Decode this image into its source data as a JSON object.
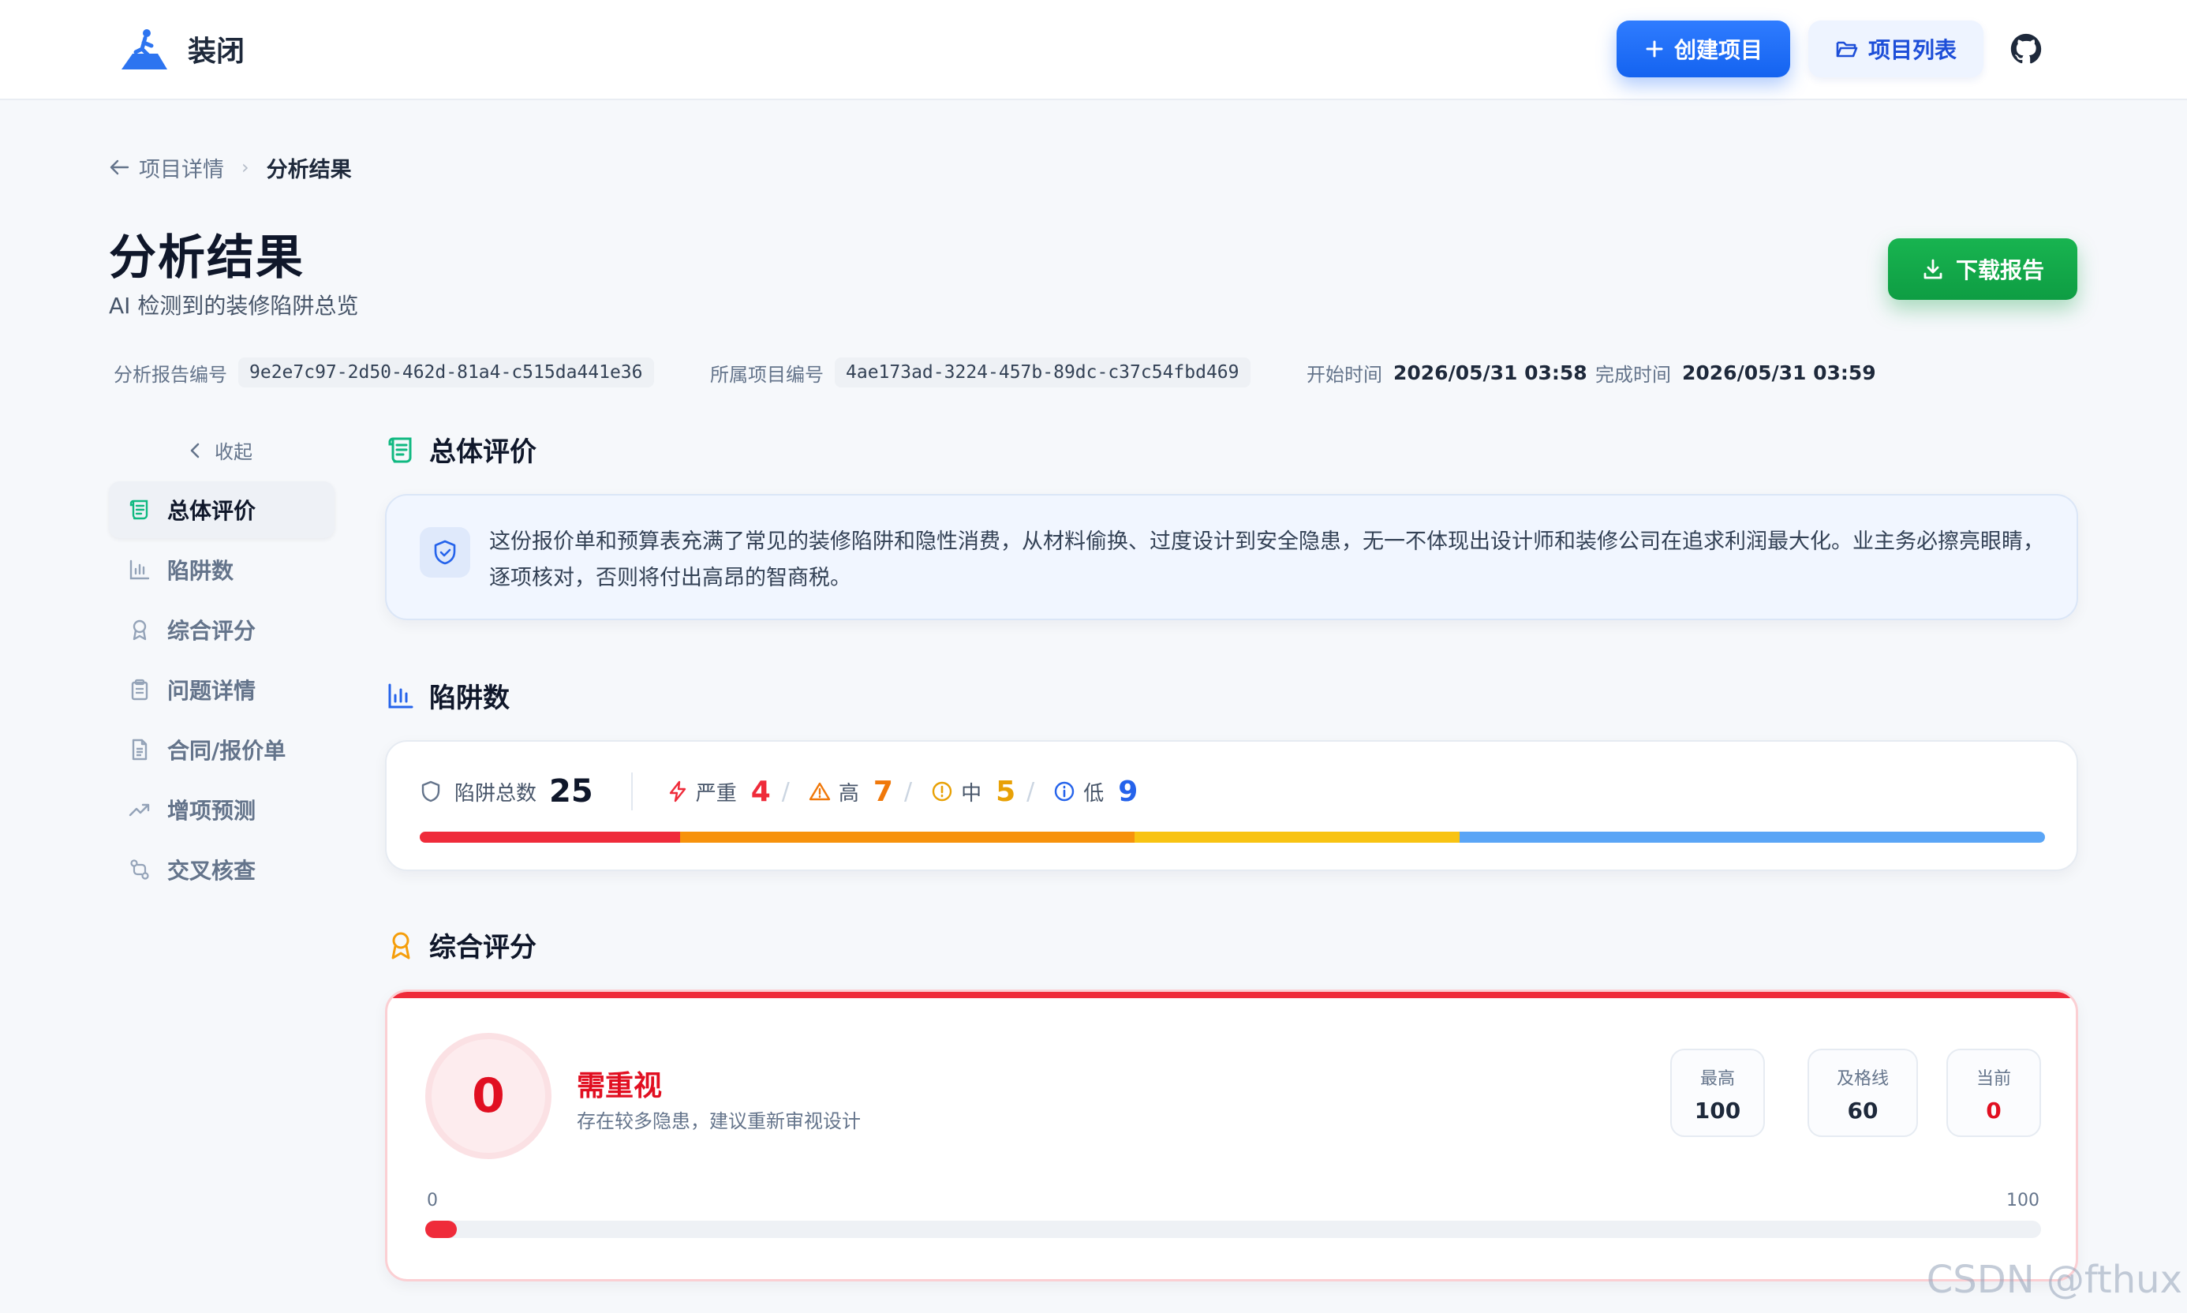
{
  "app": {
    "name": "装闭"
  },
  "topbar": {
    "create_label": "创建项目",
    "list_label": "项目列表"
  },
  "breadcrumb": {
    "back_label": "项目详情",
    "current": "分析结果"
  },
  "header": {
    "title": "分析结果",
    "subtitle": "AI 检测到的装修陷阱总览",
    "download_label": "下载报告"
  },
  "meta": {
    "report_key": "分析报告编号",
    "report_id": "9e2e7c97-2d50-462d-81a4-c515da441e36",
    "project_key": "所属项目编号",
    "project_id": "4ae173ad-3224-457b-89dc-c37c54fbd469",
    "start_key": "开始时间",
    "start_value": "2026/05/31 03:58",
    "end_key": "完成时间",
    "end_value": "2026/05/31 03:59"
  },
  "sidebar": {
    "collapse_label": "收起",
    "items": [
      {
        "label": "总体评价",
        "icon": "scroll-icon"
      },
      {
        "label": "陷阱数",
        "icon": "bar-chart-icon"
      },
      {
        "label": "综合评分",
        "icon": "award-icon"
      },
      {
        "label": "问题详情",
        "icon": "clipboard-icon"
      },
      {
        "label": "合同/报价单",
        "icon": "file-text-icon"
      },
      {
        "label": "增项预测",
        "icon": "trending-up-icon"
      },
      {
        "label": "交叉核查",
        "icon": "git-compare-icon"
      }
    ]
  },
  "overall": {
    "heading": "总体评价",
    "text": "这份报价单和预算表充满了常见的装修陷阱和隐性消费，从材料偷换、过度设计到安全隐患，无一不体现出设计师和装修公司在追求利润最大化。业主务必擦亮眼睛，逐项核对，否则将付出高昂的智商税。"
  },
  "traps": {
    "heading": "陷阱数",
    "total_label": "陷阱总数",
    "total": "25",
    "severities": [
      {
        "label": "严重",
        "count": "4",
        "color": "#ef2b3a",
        "value": 4
      },
      {
        "label": "高",
        "count": "7",
        "color": "#f0780a",
        "value": 7
      },
      {
        "label": "中",
        "count": "5",
        "color": "#e8a106",
        "value": 5
      },
      {
        "label": "低",
        "count": "9",
        "color": "#2563eb",
        "value": 9
      }
    ],
    "bar_colors": [
      "#ef2b3a",
      "#f7920c",
      "#f8c312",
      "#5aa5f6"
    ]
  },
  "score": {
    "heading": "综合评分",
    "value": "0",
    "status": "需重视",
    "desc": "存在较多隐患，建议重新审视设计",
    "max_label": "最高",
    "max_value": "100",
    "pass_label": "及格线",
    "pass_value": "60",
    "current_label": "当前",
    "current_value": "0",
    "scale_min": "0",
    "scale_max": "100",
    "progress": 0
  },
  "watermark": "CSDN @fthux"
}
